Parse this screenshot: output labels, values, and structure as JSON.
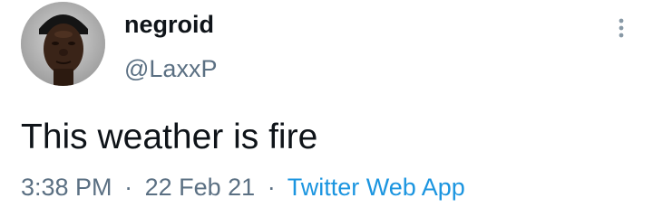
{
  "tweet": {
    "author": {
      "display_name": "negroid",
      "handle": "@LaxxP",
      "avatar_icon": "profile-photo"
    },
    "text": "This weather is fire",
    "time": "3:38 PM",
    "separator": "·",
    "date": "22 Feb 21",
    "source": "Twitter Web App",
    "menu_icon": "more-vertical-icon"
  },
  "colors": {
    "text_primary": "#0f1419",
    "text_secondary": "#5b7083",
    "link": "#1b95e0",
    "background": "#ffffff"
  }
}
